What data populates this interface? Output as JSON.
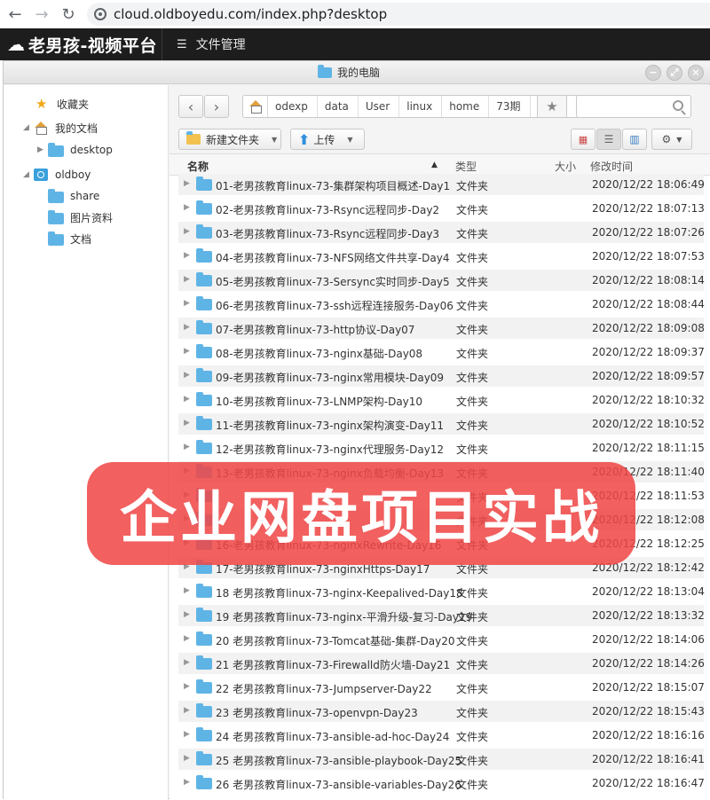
{
  "browser": {
    "back": "←",
    "forward": "→",
    "reload": "↻",
    "url": "cloud.oldboyedu.com/index.php?desktop"
  },
  "app": {
    "title": "老男孩-视频平台",
    "menu_label": "文件管理"
  },
  "window": {
    "title": "我的电脑",
    "controls": [
      "−",
      "⤢",
      "×"
    ]
  },
  "sidebar": {
    "favorites": "收藏夹",
    "my_docs": "我的文档",
    "desktop": "desktop",
    "oldboy": "oldboy",
    "share": "share",
    "pictures": "图片资料",
    "documents": "文档"
  },
  "breadcrumb": [
    "odexp",
    "data",
    "User",
    "linux",
    "home",
    "73期"
  ],
  "toolbar": {
    "new_folder": "新建文件夹",
    "upload": "上传"
  },
  "columns": {
    "name": "名称",
    "type": "类型",
    "size": "大小",
    "modified": "修改时间"
  },
  "files": [
    {
      "name": "01-老男孩教育linux-73-集群架构项目概述-Day1",
      "type": "文件夹",
      "time": "2020/12/22 18:06:49"
    },
    {
      "name": "02-老男孩教育linux-73-Rsync远程同步-Day2",
      "type": "文件夹",
      "time": "2020/12/22 18:07:13"
    },
    {
      "name": "03-老男孩教育linux-73-Rsync远程同步-Day3",
      "type": "文件夹",
      "time": "2020/12/22 18:07:26"
    },
    {
      "name": "04-老男孩教育linux-73-NFS网络文件共享-Day4",
      "type": "文件夹",
      "time": "2020/12/22 18:07:53"
    },
    {
      "name": "05-老男孩教育linux-73-Sersync实时同步-Day5",
      "type": "文件夹",
      "time": "2020/12/22 18:08:14"
    },
    {
      "name": "06-老男孩教育linux-73-ssh远程连接服务-Day06",
      "type": "文件夹",
      "time": "2020/12/22 18:08:44"
    },
    {
      "name": "07-老男孩教育linux-73-http协议-Day07",
      "type": "文件夹",
      "time": "2020/12/22 18:09:08"
    },
    {
      "name": "08-老男孩教育linux-73-nginx基础-Day08",
      "type": "文件夹",
      "time": "2020/12/22 18:09:37"
    },
    {
      "name": "09-老男孩教育linux-73-nginx常用模块-Day09",
      "type": "文件夹",
      "time": "2020/12/22 18:09:57"
    },
    {
      "name": "10-老男孩教育linux-73-LNMP架构-Day10",
      "type": "文件夹",
      "time": "2020/12/22 18:10:32"
    },
    {
      "name": "11-老男孩教育linux-73-nginx架构演变-Day11",
      "type": "文件夹",
      "time": "2020/12/22 18:10:52"
    },
    {
      "name": "12-老男孩教育linux-73-nginx代理服务-Day12",
      "type": "文件夹",
      "time": "2020/12/22 18:11:15"
    },
    {
      "name": "13-老男孩教育linux-73-nginx负载均衡-Day13",
      "type": "文件夹",
      "time": "2020/12/22 18:11:40"
    },
    {
      "name": "",
      "type": "文件夹",
      "time": "2020/12/22 18:11:53"
    },
    {
      "name": "",
      "type": "文件夹",
      "time": "2020/12/22 18:12:08"
    },
    {
      "name": "16-老男孩教育linux-73-nginxRewrite-Day16",
      "type": "文件夹",
      "time": "2020/12/22 18:12:25"
    },
    {
      "name": "17-老男孩教育linux-73-nginxHttps-Day17",
      "type": "文件夹",
      "time": "2020/12/22 18:12:42"
    },
    {
      "name": "18 老男孩教育linux-73-nginx-Keepalived-Day18",
      "type": "文件夹",
      "time": "2020/12/22 18:13:04"
    },
    {
      "name": "19 老男孩教育linux-73-nginx-平滑升级-复习-Day19",
      "type": "文件夹",
      "time": "2020/12/22 18:13:32"
    },
    {
      "name": "20 老男孩教育linux-73-Tomcat基础-集群-Day20",
      "type": "文件夹",
      "time": "2020/12/22 18:14:06"
    },
    {
      "name": "21 老男孩教育linux-73-Firewalld防火墙-Day21",
      "type": "文件夹",
      "time": "2020/12/22 18:14:26"
    },
    {
      "name": "22 老男孩教育linux-73-Jumpserver-Day22",
      "type": "文件夹",
      "time": "2020/12/22 18:15:07"
    },
    {
      "name": "23 老男孩教育linux-73-openvpn-Day23",
      "type": "文件夹",
      "time": "2020/12/22 18:15:43"
    },
    {
      "name": "24 老男孩教育linux-73-ansible-ad-hoc-Day24",
      "type": "文件夹",
      "time": "2020/12/22 18:16:16"
    },
    {
      "name": "25 老男孩教育linux-73-ansible-playbook-Day25",
      "type": "文件夹",
      "time": "2020/12/22 18:16:41"
    },
    {
      "name": "26 老男孩教育linux-73-ansible-variables-Day26",
      "type": "文件夹",
      "time": "2020/12/22 18:16:47"
    }
  ],
  "banner": "企业网盘项目实战"
}
